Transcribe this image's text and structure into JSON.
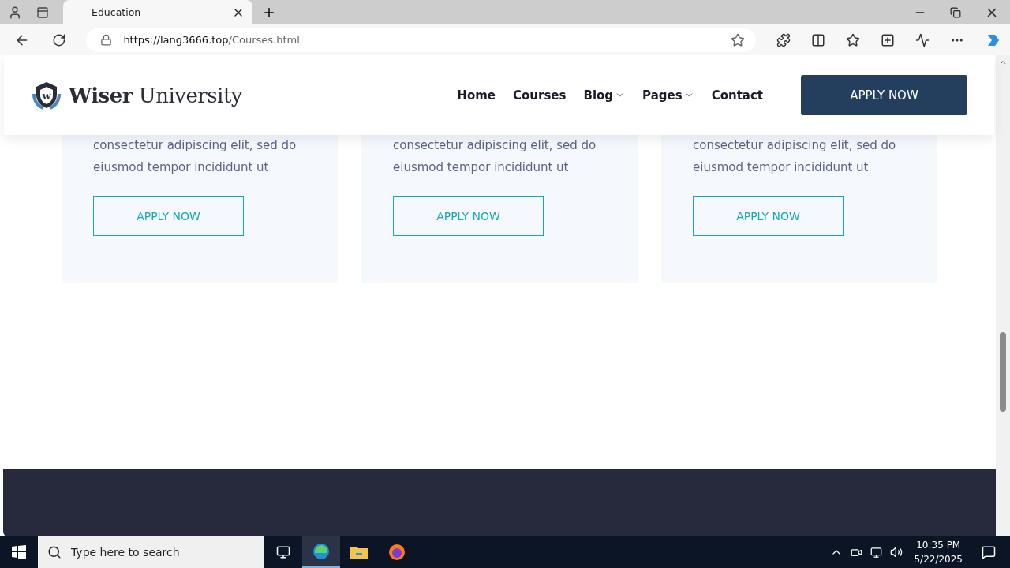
{
  "browser": {
    "tab": {
      "title": "Education"
    },
    "url": {
      "host": "https://lang3666.top",
      "path": "/Courses.html"
    }
  },
  "site": {
    "logo": {
      "bold": "Wiser",
      "rest": "University",
      "letter": "W"
    },
    "nav": [
      {
        "label": "Home",
        "dropdown": false
      },
      {
        "label": "Courses",
        "dropdown": false
      },
      {
        "label": "Blog",
        "dropdown": true
      },
      {
        "label": "Pages",
        "dropdown": true
      },
      {
        "label": "Contact",
        "dropdown": false
      }
    ],
    "apply_button": "APPLY NOW",
    "cards": [
      {
        "description": "consectetur adipiscing elit, sed do eiusmod tempor incididunt ut",
        "button": "APPLY NOW"
      },
      {
        "description": "consectetur adipiscing elit, sed do eiusmod tempor incididunt ut",
        "button": "APPLY NOW"
      },
      {
        "description": "consectetur adipiscing elit, sed do eiusmod tempor incididunt ut",
        "button": "APPLY NOW"
      }
    ]
  },
  "taskbar": {
    "search_placeholder": "Type here to search",
    "time": "10:35 PM",
    "date": "5/22/2025"
  }
}
